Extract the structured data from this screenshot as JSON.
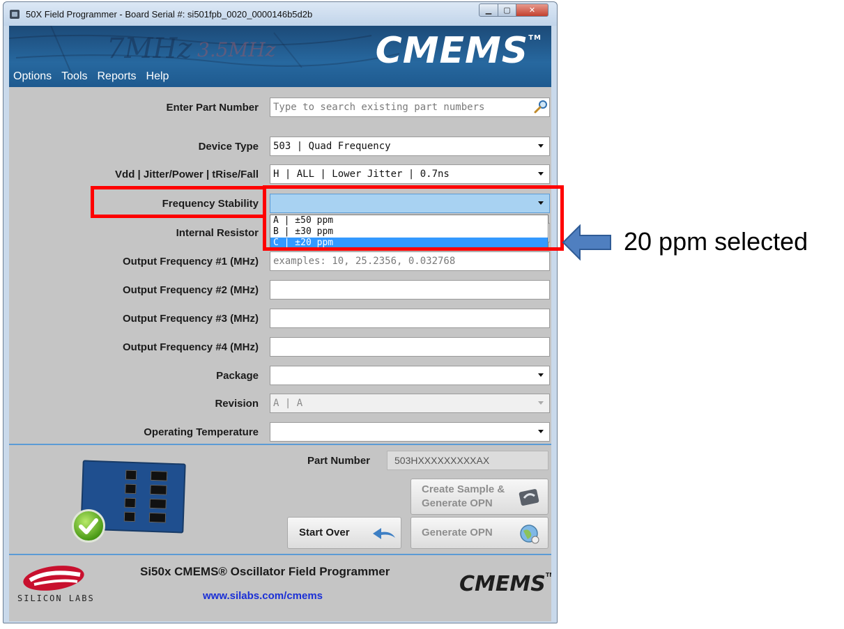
{
  "window": {
    "title": "50X Field Programmer - Board Serial #: si501fpb_0020_0000146b5d2b"
  },
  "banner": {
    "logo_text": "CMEMS",
    "scribble_1": "7MHz",
    "scribble_2": "3.5MHz"
  },
  "menu": {
    "items": [
      "Options",
      "Tools",
      "Reports",
      "Help"
    ]
  },
  "form": {
    "part_number": {
      "label": "Enter Part Number",
      "placeholder": "Type to search existing part numbers"
    },
    "device_type": {
      "label": "Device Type",
      "value": "503 | Quad Frequency"
    },
    "vdd": {
      "label": "Vdd | Jitter/Power | tRise/Fall",
      "value": "H | ALL  | Lower Jitter | 0.7ns"
    },
    "frequency_stability": {
      "label": "Frequency Stability",
      "value": "",
      "options": [
        "A | ±50 ppm",
        "B | ±30 ppm",
        "C | ±20 ppm"
      ],
      "selected_index": 2
    },
    "internal_resistor": {
      "label": "Internal Resistor"
    },
    "output_freq_1": {
      "label": "Output Frequency #1 (MHz)",
      "placeholder": "examples: 10, 25.2356, 0.032768"
    },
    "output_freq_2": {
      "label": "Output Frequency #2 (MHz)",
      "value": ""
    },
    "output_freq_3": {
      "label": "Output Frequency #3 (MHz)",
      "value": ""
    },
    "output_freq_4": {
      "label": "Output Frequency #4 (MHz)",
      "value": ""
    },
    "package": {
      "label": "Package",
      "value": ""
    },
    "revision": {
      "label": "Revision",
      "value": "A | A"
    },
    "operating_temperature": {
      "label": "Operating Temperature",
      "value": ""
    }
  },
  "result": {
    "part_number_label": "Part Number",
    "part_number_value": "503HXXXXXXXXXAX"
  },
  "buttons": {
    "create_sample_line1": "Create Sample &",
    "create_sample_line2": "Generate OPN",
    "generate_opn": "Generate OPN",
    "start_over": "Start Over"
  },
  "footer": {
    "title": "Si50x CMEMS® Oscillator Field Programmer",
    "url": "www.silabs.com/cmems",
    "company": "SILICON LABS",
    "logo_text": "CMEMS"
  },
  "annotation": {
    "text": "20 ppm selected"
  },
  "colors": {
    "highlight_red": "#ff0000",
    "selection_blue": "#3399ff",
    "banner_blue": "#27689f",
    "arrow_blue": "#4f7fc0"
  }
}
